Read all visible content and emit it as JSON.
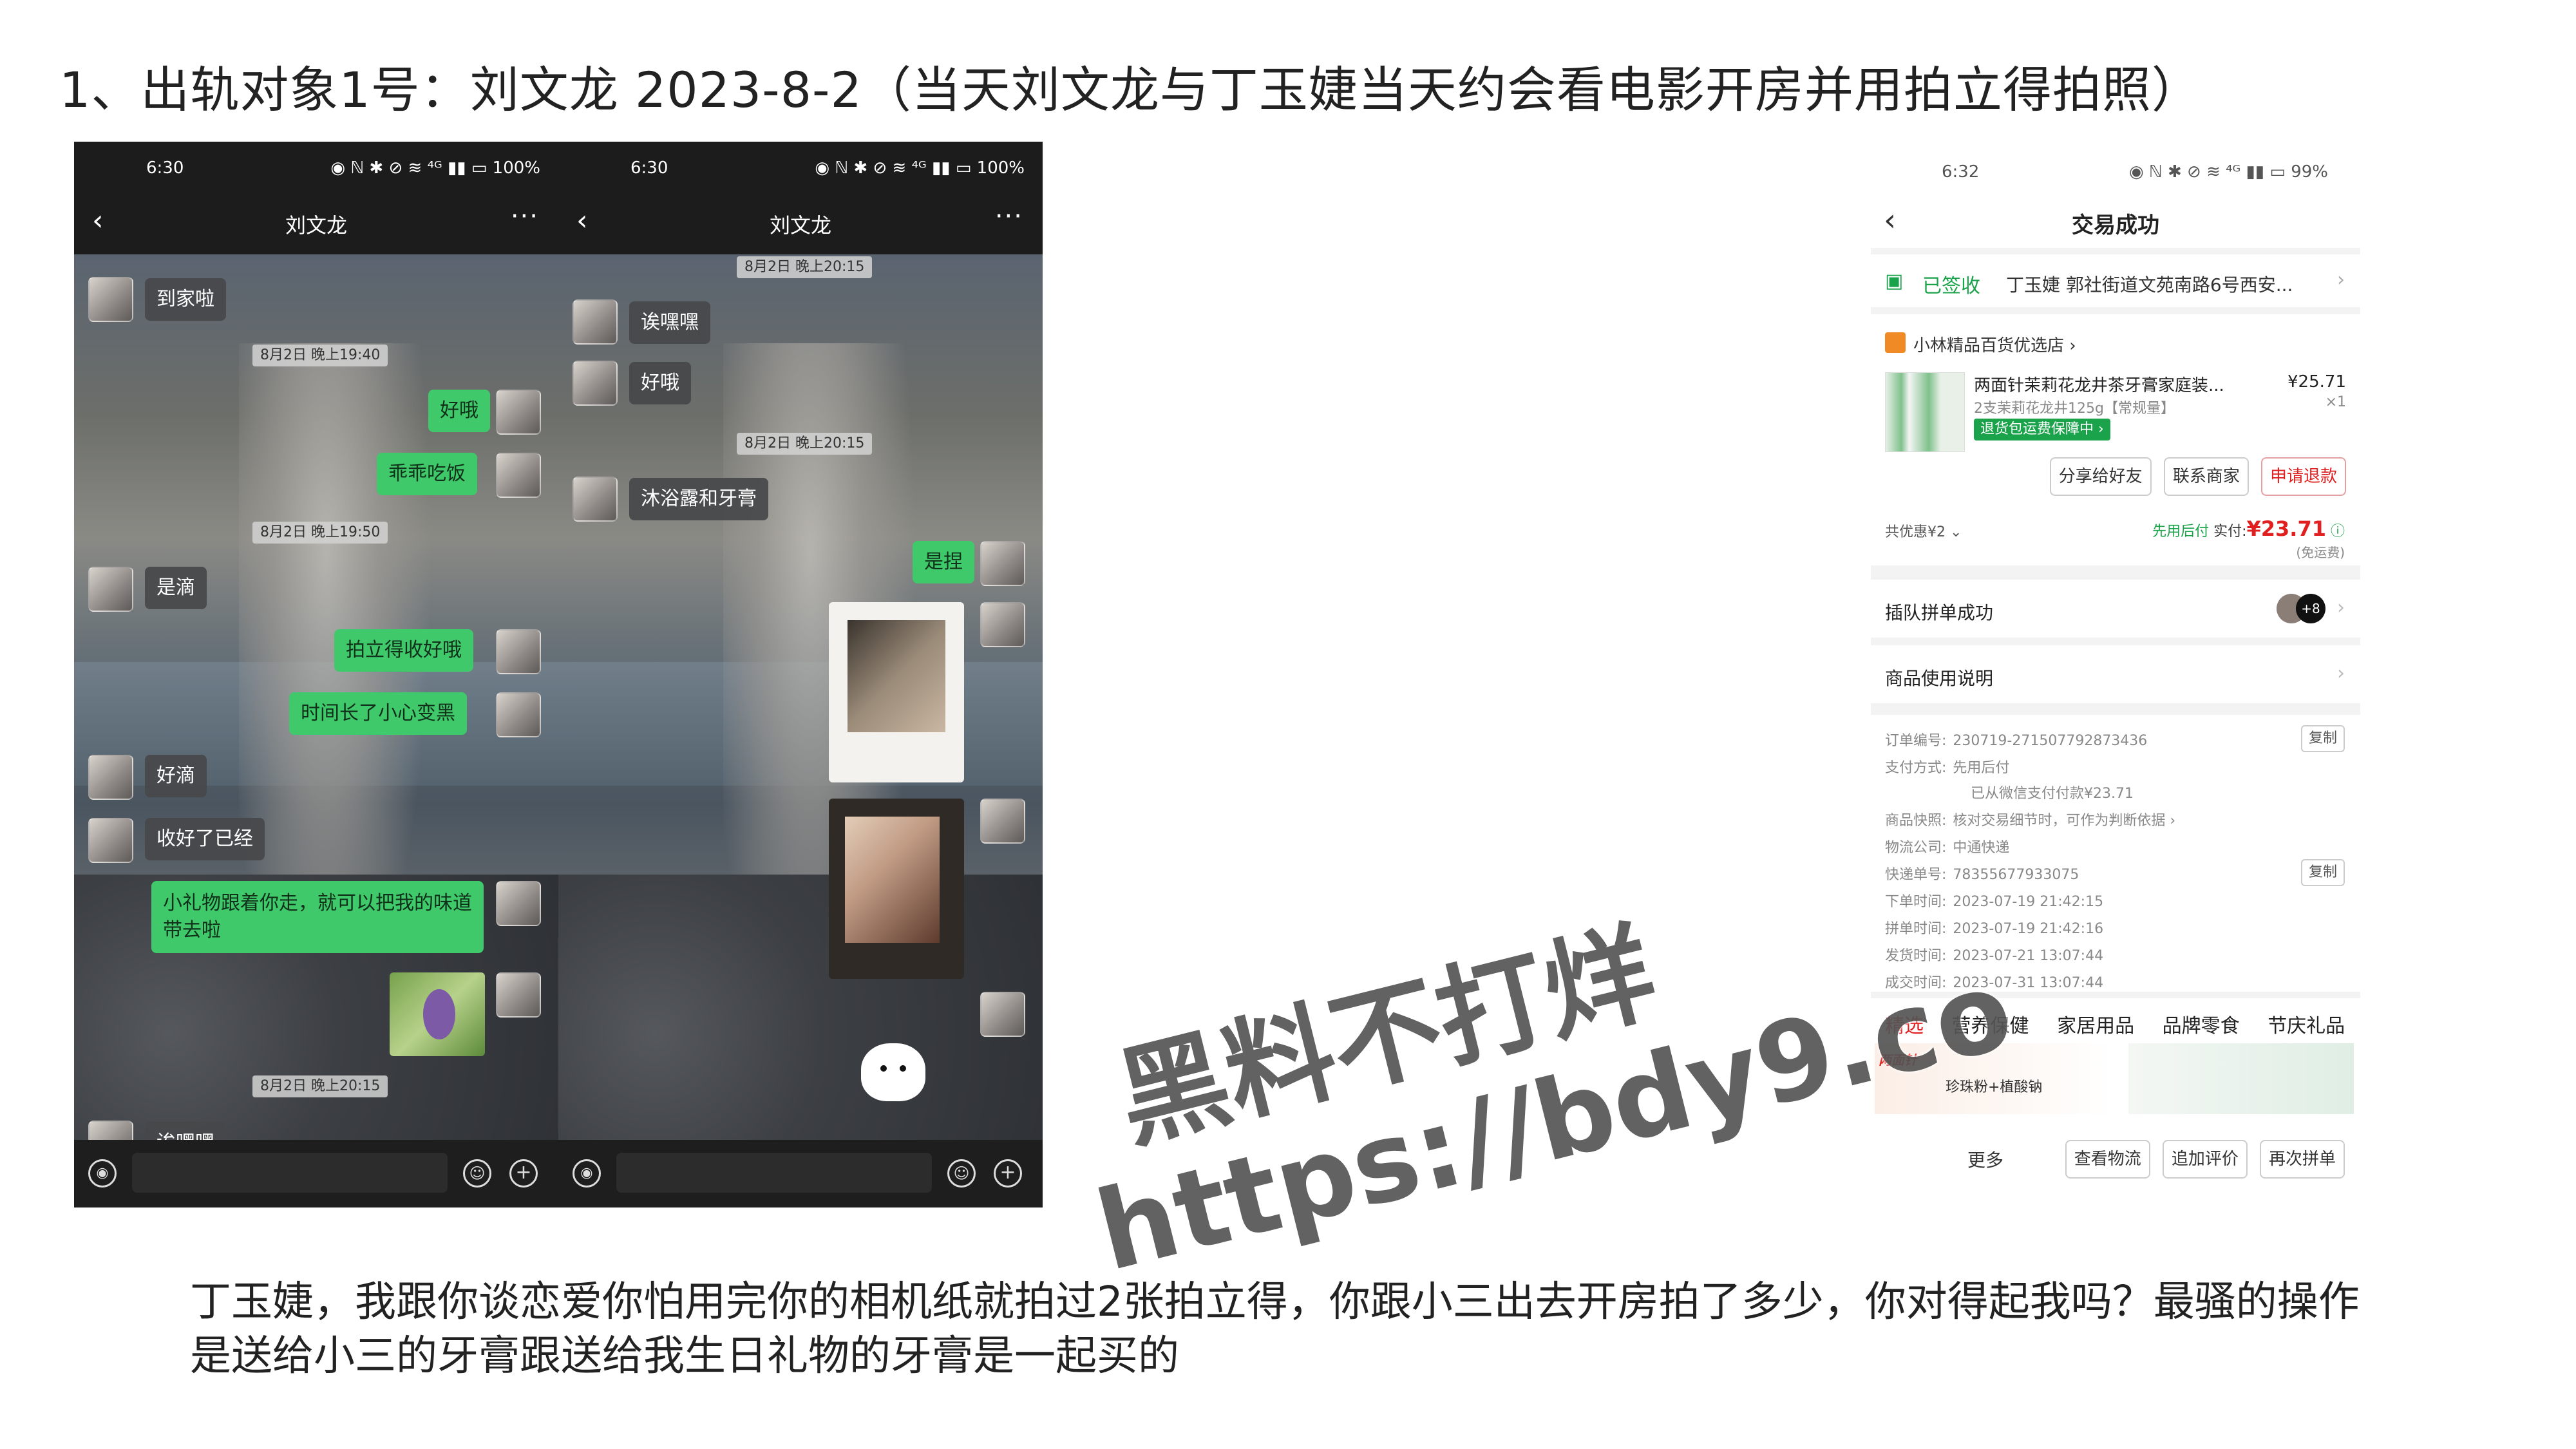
{
  "heading": "1、出轨对象1号：刘文龙  2023-8-2（当天刘文龙与丁玉婕当天约会看电影开房并用拍立得拍照）",
  "caption": "丁玉婕，我跟你谈恋爱你怕用完你的相机纸就拍过2张拍立得，你跟小三出去开房拍了多少，你对得起我吗？最骚的操作是送给小三的牙膏跟送给我生日礼物的牙膏是一起买的",
  "watermark": {
    "line1": "黑料不打烊",
    "line2": "https://bdy9.co"
  },
  "chat_left": {
    "time": "6:30",
    "status_icons": "◉ ℕ ✱ ⊘ ≋ ⁴ᴳ ▮▮ ▭ 100%",
    "title": "刘文龙",
    "back": "‹",
    "more": "···",
    "messages": {
      "m1": "到家啦",
      "s1": "8月2日 晚上19:40",
      "m2": "好哦",
      "m3": "乖乖吃饭",
      "s2": "8月2日 晚上19:50",
      "m4": "是滴",
      "m5": "拍立得收好哦",
      "m6": "时间长了小心变黑",
      "m7": "好滴",
      "m8": "收好了已经",
      "m9": "小礼物跟着你走，就可以把我的味道带去啦",
      "s3": "8月2日 晚上20:15",
      "m10": "诶嘿嘿"
    }
  },
  "chat_mid": {
    "time": "6:30",
    "status_icons": "◉ ℕ ✱ ⊘ ≋ ⁴ᴳ ▮▮ ▭ 100%",
    "title": "刘文龙",
    "back": "‹",
    "more": "···",
    "messages": {
      "s1": "8月2日 晚上20:15",
      "m1": "诶嘿嘿",
      "m2": "好哦",
      "s2": "8月2日 晚上20:15",
      "m3": "沐浴露和牙膏",
      "m4": "是捏"
    }
  },
  "input_icons": {
    "voice": "◉",
    "emoji": "☺",
    "plus": "+"
  },
  "order": {
    "time": "6:32",
    "status_icons": "◉ ℕ ✱ ⊘ ≋ ⁴ᴳ ▮▮ ▭ 99%",
    "title": "交易成功",
    "back": "‹",
    "sign_label": "已签收",
    "address": "丁玉婕 郭社街道文苑南路6号西安...",
    "shop": "小林精品百货优选店 ›",
    "product_name": "两面针茉莉花龙井茶牙膏家庭装...",
    "product_price": "¥25.71",
    "product_qty": "×1",
    "product_spec": "2支茉莉花龙井125g【常规量】",
    "product_badge": "退货包运费保障中 ›",
    "btn_share": "分享给好友",
    "btn_contact": "联系商家",
    "btn_refund": "申请退款",
    "discount": "共优惠¥2 ⌄",
    "pay_later": "先用后付",
    "paid_label": "实付:",
    "paid_amount": "¥23.71",
    "free_shipping": "(免运费)",
    "group_success": "插队拼单成功",
    "group_count": "+8",
    "usage": "商品使用说明",
    "info": {
      "order_no_label": "订单编号:",
      "order_no": "230719-271507792873436",
      "pay_method_label": "支付方式:",
      "pay_method": "先用后付",
      "pay_note": "已从微信支付付款¥23.71",
      "snapshot_label": "商品快照:",
      "snapshot": "核对交易细节时，可作为判断依据 ›",
      "logistics_label": "物流公司:",
      "logistics": "中通快递",
      "tracking_label": "快递单号:",
      "tracking": "78355677933075",
      "order_time_label": "下单时间:",
      "order_time": "2023-07-19 21:42:15",
      "group_time_label": "拼单时间:",
      "group_time": "2023-07-19 21:42:16",
      "ship_time_label": "发货时间:",
      "ship_time": "2023-07-21 13:07:44",
      "done_time_label": "成交时间:",
      "done_time": "2023-07-31 13:07:44",
      "copy": "复制"
    },
    "tabs": [
      "精选",
      "营养保健",
      "家居用品",
      "品牌零食",
      "节庆礼品"
    ],
    "promo_brand": "两面针",
    "promo_text": "珍珠粉+植酸钠",
    "more": "更多",
    "btn_logistics": "查看物流",
    "btn_review": "追加评价",
    "btn_regroup": "再次拼单"
  }
}
